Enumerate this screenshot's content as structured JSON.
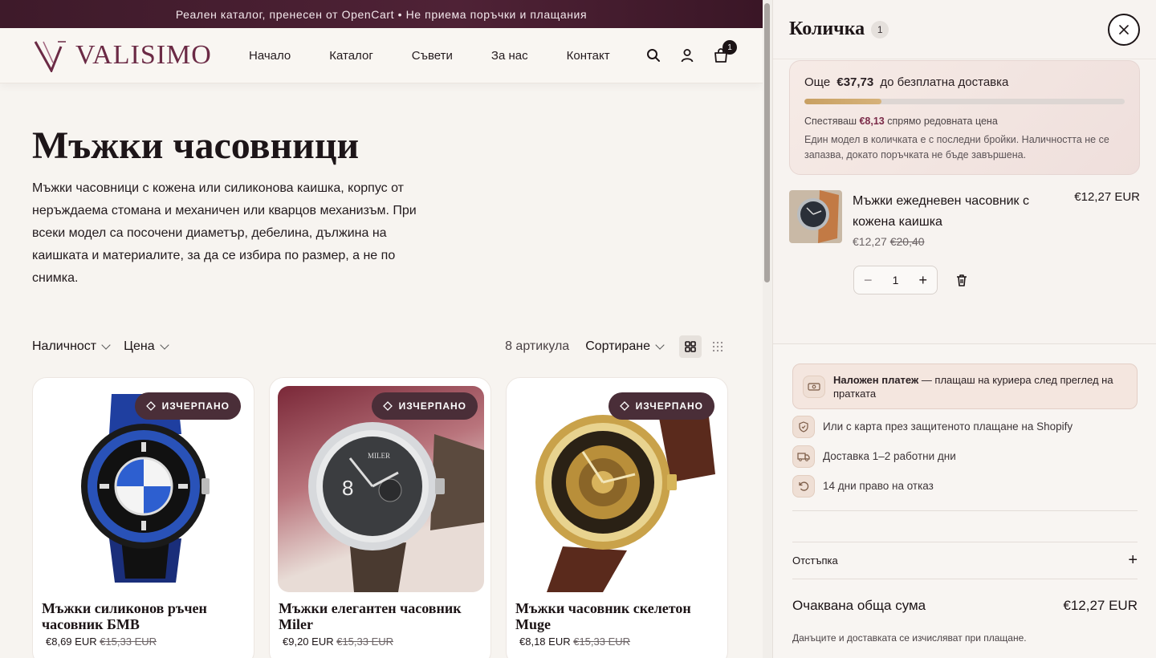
{
  "topbar": {
    "text": "Реален каталог, пренесен от OpenCart • Не приема поръчки и плащания"
  },
  "brand": {
    "name": "VALISIMO",
    "color": "#6b2a45"
  },
  "nav": [
    "Начало",
    "Каталог",
    "Съвети",
    "За нас",
    "Контакт"
  ],
  "header_icons": [
    "search-icon",
    "user-icon",
    "cart-icon"
  ],
  "cart_badge": "1",
  "hero": {
    "title": "Мъжки часовници",
    "description": "Мъжки часовници с кожена или силиконова каишка, корпус от неръждаема стомана и механичен или кварцов механизъм. При всеки модел са посочени диаметър, дебелина, дължина на каишката и материалите, за да се избира по размер, а не по снимка."
  },
  "filters": {
    "availability": "Наличност",
    "price": "Цена",
    "count": "8 артикула",
    "sort": "Сортиране"
  },
  "products": [
    {
      "badge": "ИЗЧЕРПАНО",
      "title": "Мъжки силиконов ръчен часовник БМВ",
      "price": "€8,69 EUR",
      "old_price": "€15,33 EUR"
    },
    {
      "badge": "ИЗЧЕРПАНО",
      "title": "Мъжки елегантен часовник Miler",
      "price": "€9,20 EUR",
      "old_price": "€15,33 EUR"
    },
    {
      "badge": "ИЗЧЕРПАНО",
      "title": "Мъжки часовник скелетон Muge",
      "price": "€8,18 EUR",
      "old_price": "€15,33 EUR"
    }
  ],
  "drawer": {
    "title": "Количка",
    "count": "1",
    "shipping": {
      "prefix": "Още",
      "amount": "€37,73",
      "suffix": "до безплатна доставка",
      "progress": 0.24
    },
    "savings": {
      "prefix": "Спестяваш",
      "amount": "€8,13",
      "suffix": "спрямо редовната цена"
    },
    "stock_note": "Един модел в количката е с последни бройки. Наличността не се запазва, докато поръчката не бъде завършена.",
    "item": {
      "name": "Мъжки ежедневен часовник с кожена каишка",
      "price": "€12,27 EUR",
      "unit_price": "€12,27",
      "old_price": "€20,40",
      "qty": "1"
    },
    "cod": {
      "bold": "Наложен платеж",
      "rest": " — плащаш на куриера след преглед на пратката"
    },
    "features": [
      {
        "icon": "shield-icon",
        "text": "Или с карта през защитеното плащане на Shopify"
      },
      {
        "icon": "truck-icon",
        "text": "Доставка 1–2 работни дни"
      },
      {
        "icon": "return-icon",
        "text": "14 дни право на отказ"
      }
    ],
    "discount_label": "Отстъпка",
    "total_label": "Очаквана обща сума",
    "total_amount": "€12,27 EUR",
    "tax_note": "Данъците и доставката се изчисляват при плащане."
  }
}
